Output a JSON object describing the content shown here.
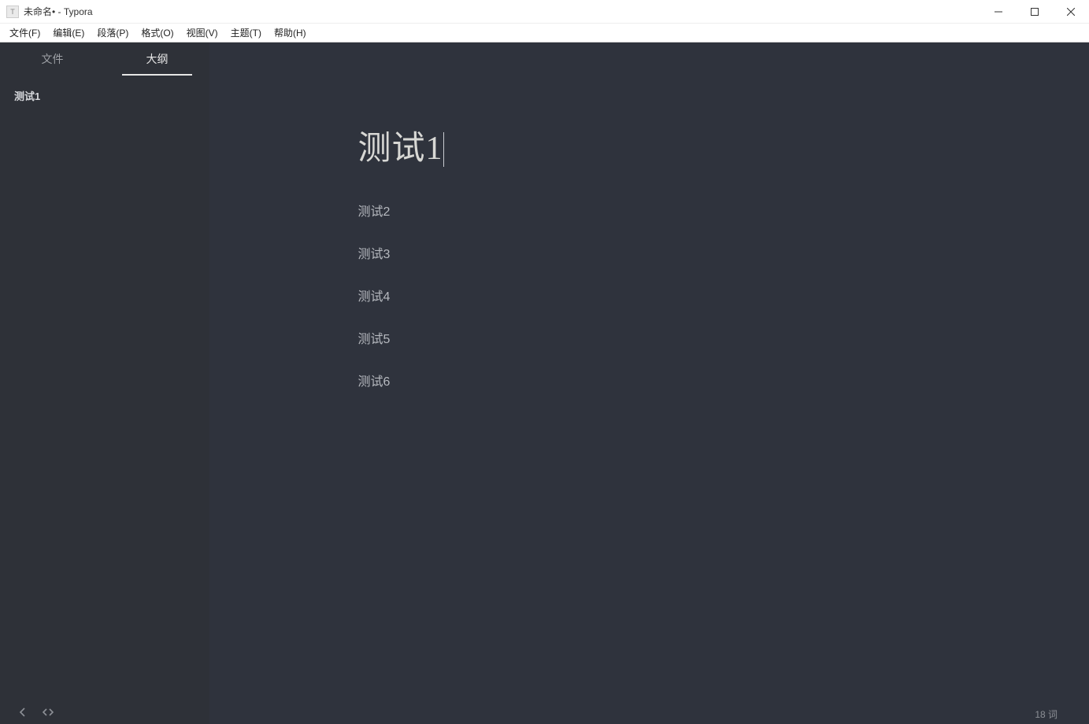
{
  "window": {
    "title": "未命名• - Typora",
    "icon_text": "T"
  },
  "menubar": {
    "items": [
      "文件(F)",
      "编辑(E)",
      "段落(P)",
      "格式(O)",
      "视图(V)",
      "主题(T)",
      "帮助(H)"
    ]
  },
  "sidebar": {
    "tabs": {
      "files": "文件",
      "outline": "大纲"
    },
    "active_tab": "outline",
    "outline": [
      {
        "label": "测试1"
      }
    ]
  },
  "editor": {
    "heading": "测试1",
    "paragraphs": [
      "测试2",
      "测试3",
      "测试4",
      "测试5",
      "测试6"
    ]
  },
  "statusbar": {
    "word_count": "18 词"
  }
}
